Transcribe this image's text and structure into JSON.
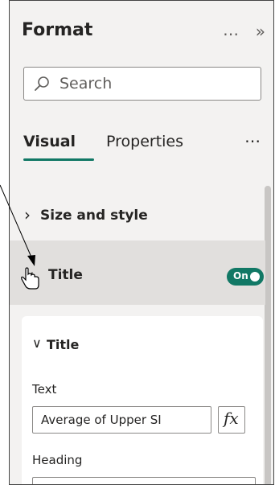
{
  "pane": {
    "title": "Format",
    "more_glyph": "⋯",
    "collapse_glyph": "»"
  },
  "search": {
    "placeholder": "Search"
  },
  "tabs": [
    {
      "label": "Visual",
      "active": true
    },
    {
      "label": "Properties",
      "active": false
    }
  ],
  "tabs_more_glyph": "⋯",
  "sections": {
    "size_style": {
      "label": "Size and style",
      "expanded": false
    },
    "title": {
      "label": "Title",
      "expanded": true,
      "toggle_label": "On"
    }
  },
  "title_card": {
    "heading": "Title",
    "text_label": "Text",
    "text_value": "Average of Upper SI",
    "fx_label": "fx",
    "heading_label": "Heading"
  },
  "colors": {
    "accent": "#117865",
    "panel_bg": "#f3f2f1",
    "selected_section_bg": "#e1dfdd"
  }
}
